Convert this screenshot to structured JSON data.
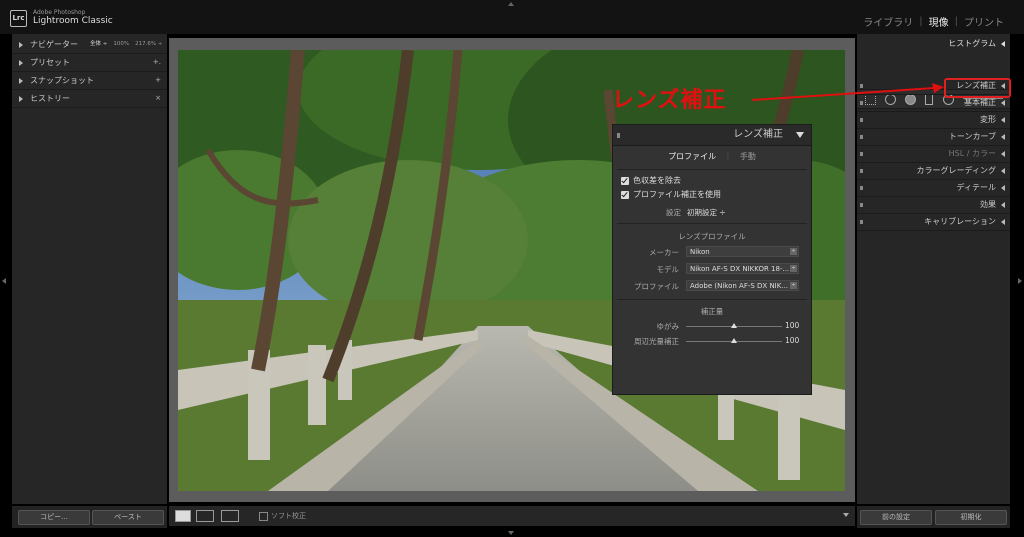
{
  "app": {
    "vendor": "Adobe Photoshop",
    "name": "Lightroom Classic",
    "logo": "Lrc"
  },
  "modules": [
    {
      "label": "ライブラリ",
      "active": false
    },
    {
      "label": "現像",
      "active": true
    },
    {
      "label": "プリント",
      "active": false
    }
  ],
  "left_panel": {
    "navigator": {
      "label": "ナビゲーター",
      "zoom_options": [
        "全体 ÷",
        "100%",
        "217.6% ÷"
      ]
    },
    "sections": [
      {
        "label": "プリセット",
        "extra": "+."
      },
      {
        "label": "スナップショット",
        "extra": "+"
      },
      {
        "label": "ヒストリー",
        "extra": "×"
      }
    ]
  },
  "right_panel": {
    "histogram_label": "ヒストグラム",
    "sections": [
      {
        "label": "レンズ補正",
        "highlighted": true
      },
      {
        "label": "基本補正",
        "highlighted": false
      },
      {
        "label": "変形",
        "highlighted": false
      },
      {
        "label": "トーンカーブ",
        "highlighted": false
      },
      {
        "label": "HSL / カラー",
        "highlighted": false
      },
      {
        "label": "カラーグレーディング",
        "highlighted": false
      },
      {
        "label": "ディテール",
        "highlighted": false
      },
      {
        "label": "効果",
        "highlighted": false
      },
      {
        "label": "キャリブレーション",
        "highlighted": false
      }
    ]
  },
  "bottom": {
    "copy_button": "コピー...",
    "paste_button": "ペースト",
    "soft_proof_label": "ソフト校正",
    "previous_button": "前の設定",
    "reset_button": "初期化"
  },
  "callout": {
    "text": "レンズ補正",
    "color": "#e01010"
  },
  "lens_panel": {
    "title": "レンズ補正",
    "tabs": [
      {
        "label": "プロファイル",
        "active": true
      },
      {
        "label": "手動",
        "active": false
      }
    ],
    "checkboxes": [
      {
        "label": "色収差を除去",
        "checked": true
      },
      {
        "label": "プロファイル補正を使用",
        "checked": true
      }
    ],
    "setup": {
      "label": "設定",
      "value": "初期設定 ÷"
    },
    "lens_profile_title": "レンズプロファイル",
    "profile_fields": [
      {
        "label": "メーカー",
        "value": "Nikon"
      },
      {
        "label": "モデル",
        "value": "Nikon AF-S DX NIKKOR 18-..."
      },
      {
        "label": "プロファイル",
        "value": "Adobe (Nikon AF-S DX NIK..."
      }
    ],
    "amount_title": "補正量",
    "sliders": [
      {
        "label": "ゆがみ",
        "value": "100",
        "level": 0.5
      },
      {
        "label": "周辺光量補正",
        "value": "100",
        "level": 0.5
      }
    ]
  }
}
